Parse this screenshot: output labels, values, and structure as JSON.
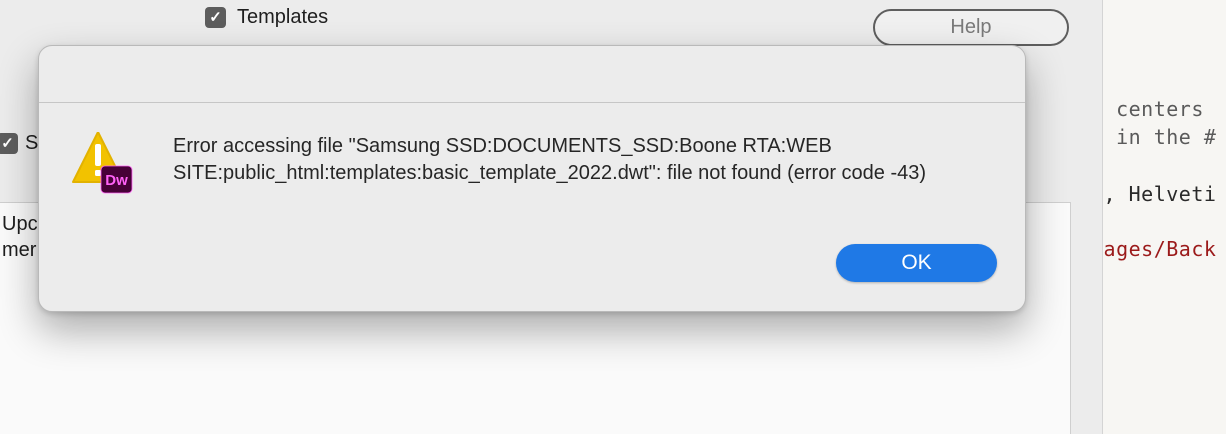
{
  "background": {
    "templates_checkbox": {
      "label": "Templates",
      "checked": true
    },
    "second_checkbox": {
      "label_partial": "S",
      "checked": true
    },
    "help_button": "Help",
    "panel_text_lines": [
      "Upc",
      "mer"
    ]
  },
  "code_editor": {
    "lines": [
      {
        "text": "s centers",
        "color": "#5a5a5a"
      },
      {
        "text": "t in the #",
        "color": "#5a5a5a"
      },
      {
        "text": "l, Helveti",
        "color": "#2a2a2a"
      },
      {
        "text": "mages/Back",
        "color": "#9b1a1a"
      }
    ]
  },
  "dialog": {
    "app_icon": "dreamweaver-warning-icon",
    "app_badge": "Dw",
    "message": "Error accessing file \"Samsung SSD:DOCUMENTS_SSD:Boone RTA:WEB SITE:public_html:templates:basic_template_2022.dwt\": file not found (error code -43)",
    "ok_button": "OK"
  },
  "colors": {
    "accent": "#1f79e6",
    "warning": "#f2c200",
    "dw_badge_bg": "#470137",
    "dw_badge_text": "#ff61f6"
  }
}
